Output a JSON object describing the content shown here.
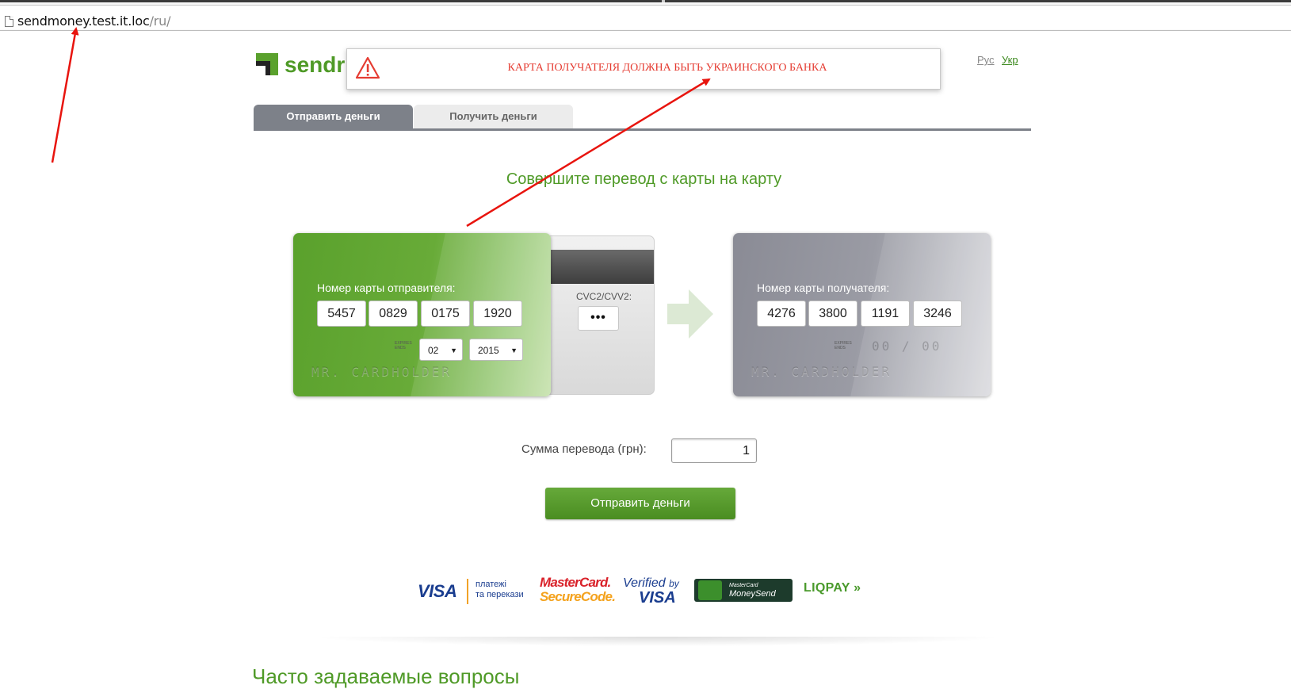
{
  "browser": {
    "url_host": "sendmoney.test.it.loc",
    "url_path": "/ru/"
  },
  "header": {
    "logo_text": "sendr",
    "lang_ru": "Рус",
    "lang_uk": "Укр"
  },
  "alert": {
    "icon": "warning-triangle-icon",
    "message": "КАРТА ПОЛУЧАТЕЛЯ ДОЛЖНА БЫТЬ УКРАИНСКОГО БАНКА",
    "color": "#e53c32"
  },
  "tabs": [
    {
      "label": "Отправить деньги",
      "active": true
    },
    {
      "label": "Получить деньги",
      "active": false
    }
  ],
  "headline": "Совершите перевод с карты на карту",
  "sender_card": {
    "label": "Номер карты отправителя:",
    "number_groups": [
      "5457",
      "0829",
      "0175",
      "1920"
    ],
    "expires_label": "EXPIRES ENDS",
    "month": "02",
    "year": "2015",
    "holder": "MR. CARDHOLDER",
    "cvc_label": "CVC2/CVV2:",
    "cvc_value": "•••",
    "color": "#5aa12c"
  },
  "receiver_card": {
    "label": "Номер карты получателя:",
    "number_groups": [
      "4276",
      "3800",
      "1191",
      "3246"
    ],
    "expires_label": "EXPIRES ENDS",
    "expiry_placeholder": "00 / 00",
    "holder": "MR. CARDHOLDER",
    "color": "#8a8b95"
  },
  "amount": {
    "label": "Сумма перевода (грн):",
    "value": "1"
  },
  "send_button": "Отправить деньги",
  "payment_logos": {
    "visa": "VISA",
    "platezhi_line1": "платежі",
    "platezhi_line2": "та перекази",
    "mastercard_line1": "MasterCard.",
    "mastercard_line2": "SecureCode.",
    "verified_line1": "Verified",
    "verified_by": "by",
    "verified_line2": "VISA",
    "moneysend_small": "MasterCard",
    "moneysend_big": "MoneySend",
    "liqpay": "LIQPAY"
  },
  "faq_title": "Часто задаваемые вопросы"
}
